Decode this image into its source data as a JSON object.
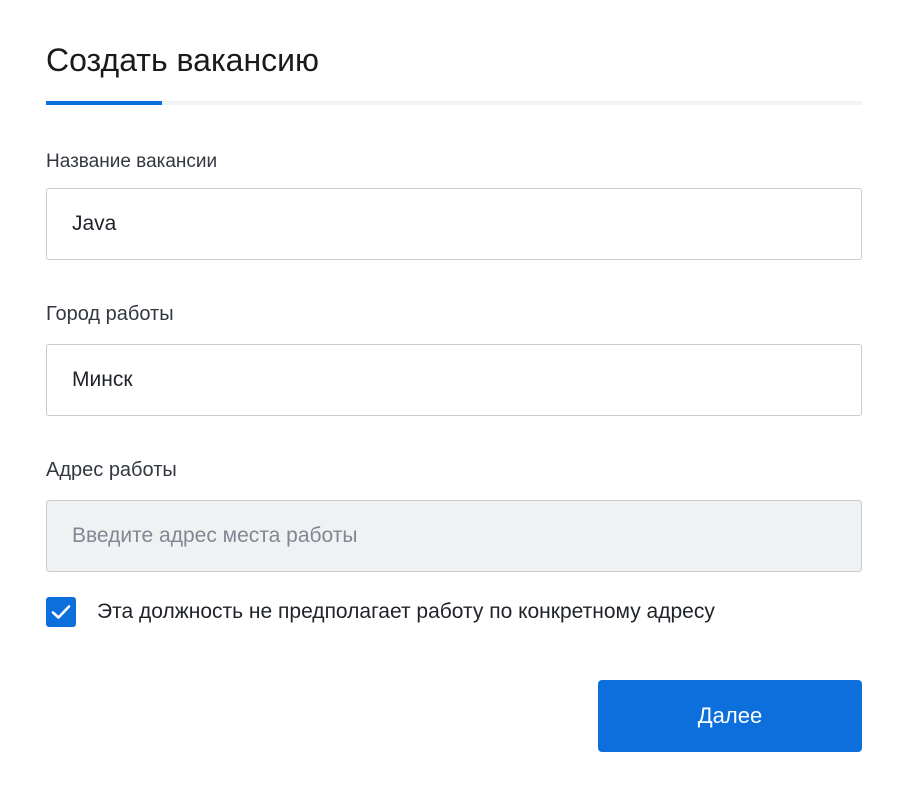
{
  "header": {
    "title": "Создать вакансию",
    "progress_fraction": 0.142
  },
  "form": {
    "vacancy_name": {
      "label": "Название вакансии",
      "value": "Java",
      "placeholder": ""
    },
    "city": {
      "label": "Город работы",
      "value": "Минск",
      "placeholder": ""
    },
    "address": {
      "label": "Адрес работы",
      "value": "",
      "placeholder": "Введите адрес места работы",
      "disabled": true
    },
    "no_address_checkbox": {
      "label": "Эта должность не предполагает работу по конкретному адресу",
      "checked": true
    }
  },
  "actions": {
    "next_label": "Далее"
  },
  "colors": {
    "accent": "#0c6fdc",
    "track": "#f1f2f4",
    "disabled_bg": "#f0f1f3",
    "border": "#c8ccd2"
  },
  "icons": {
    "checkbox": "checkmark-icon"
  }
}
